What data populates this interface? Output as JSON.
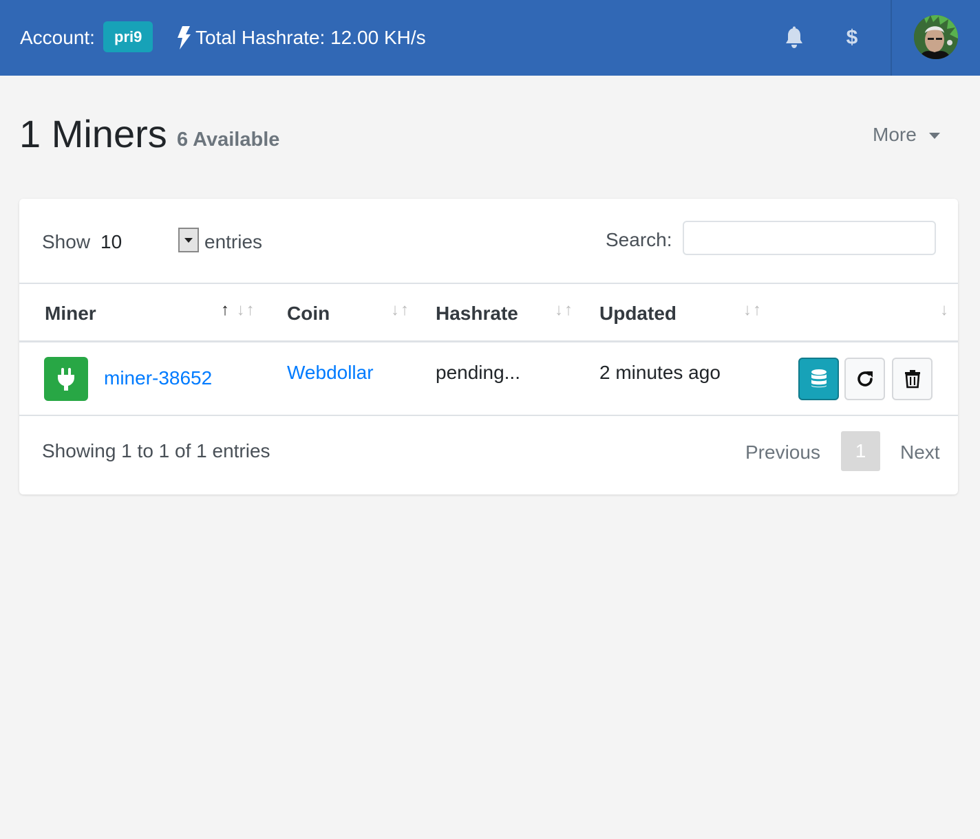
{
  "navbar": {
    "account_label": "Account:",
    "account_badge": "pri9",
    "hashrate_text": "Total Hashrate: 12.00 KH/s",
    "dollar_symbol": "$",
    "icons": [
      "bolt-icon",
      "bell-icon",
      "dollar-icon"
    ],
    "brand_color": "#3168b5"
  },
  "header": {
    "title": "1 Miners",
    "subtitle": "6 Available",
    "more_label": "More"
  },
  "table_controls": {
    "show_label": "Show",
    "page_length": "10",
    "entries_label": "entries",
    "search_label": "Search:",
    "search_value": ""
  },
  "table": {
    "columns": [
      "Miner",
      "Coin",
      "Hashrate",
      "Updated",
      ""
    ],
    "sort": {
      "column": "Miner",
      "direction": "ascending"
    },
    "rows": [
      {
        "miner": "miner-38652",
        "coin": "Webdollar",
        "hashrate": "pending...",
        "updated": "2 minutes ago",
        "status_icon": "plug-icon",
        "status_color": "#28a745",
        "actions": [
          "database-icon",
          "refresh-icon",
          "trash-icon"
        ]
      }
    ]
  },
  "footer": {
    "info": "Showing 1 to 1 of 1 entries",
    "previous": "Previous",
    "current_page": "1",
    "next": "Next"
  }
}
